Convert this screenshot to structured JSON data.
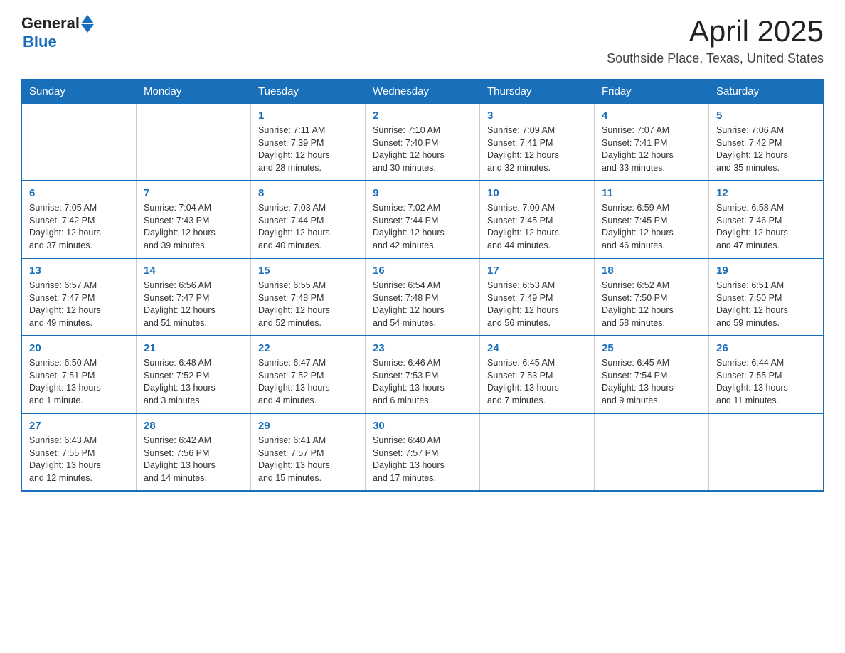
{
  "header": {
    "logo_general": "General",
    "logo_blue": "Blue",
    "month_year": "April 2025",
    "location": "Southside Place, Texas, United States"
  },
  "days_of_week": [
    "Sunday",
    "Monday",
    "Tuesday",
    "Wednesday",
    "Thursday",
    "Friday",
    "Saturday"
  ],
  "weeks": [
    [
      {
        "day": "",
        "info": ""
      },
      {
        "day": "",
        "info": ""
      },
      {
        "day": "1",
        "info": "Sunrise: 7:11 AM\nSunset: 7:39 PM\nDaylight: 12 hours\nand 28 minutes."
      },
      {
        "day": "2",
        "info": "Sunrise: 7:10 AM\nSunset: 7:40 PM\nDaylight: 12 hours\nand 30 minutes."
      },
      {
        "day": "3",
        "info": "Sunrise: 7:09 AM\nSunset: 7:41 PM\nDaylight: 12 hours\nand 32 minutes."
      },
      {
        "day": "4",
        "info": "Sunrise: 7:07 AM\nSunset: 7:41 PM\nDaylight: 12 hours\nand 33 minutes."
      },
      {
        "day": "5",
        "info": "Sunrise: 7:06 AM\nSunset: 7:42 PM\nDaylight: 12 hours\nand 35 minutes."
      }
    ],
    [
      {
        "day": "6",
        "info": "Sunrise: 7:05 AM\nSunset: 7:42 PM\nDaylight: 12 hours\nand 37 minutes."
      },
      {
        "day": "7",
        "info": "Sunrise: 7:04 AM\nSunset: 7:43 PM\nDaylight: 12 hours\nand 39 minutes."
      },
      {
        "day": "8",
        "info": "Sunrise: 7:03 AM\nSunset: 7:44 PM\nDaylight: 12 hours\nand 40 minutes."
      },
      {
        "day": "9",
        "info": "Sunrise: 7:02 AM\nSunset: 7:44 PM\nDaylight: 12 hours\nand 42 minutes."
      },
      {
        "day": "10",
        "info": "Sunrise: 7:00 AM\nSunset: 7:45 PM\nDaylight: 12 hours\nand 44 minutes."
      },
      {
        "day": "11",
        "info": "Sunrise: 6:59 AM\nSunset: 7:45 PM\nDaylight: 12 hours\nand 46 minutes."
      },
      {
        "day": "12",
        "info": "Sunrise: 6:58 AM\nSunset: 7:46 PM\nDaylight: 12 hours\nand 47 minutes."
      }
    ],
    [
      {
        "day": "13",
        "info": "Sunrise: 6:57 AM\nSunset: 7:47 PM\nDaylight: 12 hours\nand 49 minutes."
      },
      {
        "day": "14",
        "info": "Sunrise: 6:56 AM\nSunset: 7:47 PM\nDaylight: 12 hours\nand 51 minutes."
      },
      {
        "day": "15",
        "info": "Sunrise: 6:55 AM\nSunset: 7:48 PM\nDaylight: 12 hours\nand 52 minutes."
      },
      {
        "day": "16",
        "info": "Sunrise: 6:54 AM\nSunset: 7:48 PM\nDaylight: 12 hours\nand 54 minutes."
      },
      {
        "day": "17",
        "info": "Sunrise: 6:53 AM\nSunset: 7:49 PM\nDaylight: 12 hours\nand 56 minutes."
      },
      {
        "day": "18",
        "info": "Sunrise: 6:52 AM\nSunset: 7:50 PM\nDaylight: 12 hours\nand 58 minutes."
      },
      {
        "day": "19",
        "info": "Sunrise: 6:51 AM\nSunset: 7:50 PM\nDaylight: 12 hours\nand 59 minutes."
      }
    ],
    [
      {
        "day": "20",
        "info": "Sunrise: 6:50 AM\nSunset: 7:51 PM\nDaylight: 13 hours\nand 1 minute."
      },
      {
        "day": "21",
        "info": "Sunrise: 6:48 AM\nSunset: 7:52 PM\nDaylight: 13 hours\nand 3 minutes."
      },
      {
        "day": "22",
        "info": "Sunrise: 6:47 AM\nSunset: 7:52 PM\nDaylight: 13 hours\nand 4 minutes."
      },
      {
        "day": "23",
        "info": "Sunrise: 6:46 AM\nSunset: 7:53 PM\nDaylight: 13 hours\nand 6 minutes."
      },
      {
        "day": "24",
        "info": "Sunrise: 6:45 AM\nSunset: 7:53 PM\nDaylight: 13 hours\nand 7 minutes."
      },
      {
        "day": "25",
        "info": "Sunrise: 6:45 AM\nSunset: 7:54 PM\nDaylight: 13 hours\nand 9 minutes."
      },
      {
        "day": "26",
        "info": "Sunrise: 6:44 AM\nSunset: 7:55 PM\nDaylight: 13 hours\nand 11 minutes."
      }
    ],
    [
      {
        "day": "27",
        "info": "Sunrise: 6:43 AM\nSunset: 7:55 PM\nDaylight: 13 hours\nand 12 minutes."
      },
      {
        "day": "28",
        "info": "Sunrise: 6:42 AM\nSunset: 7:56 PM\nDaylight: 13 hours\nand 14 minutes."
      },
      {
        "day": "29",
        "info": "Sunrise: 6:41 AM\nSunset: 7:57 PM\nDaylight: 13 hours\nand 15 minutes."
      },
      {
        "day": "30",
        "info": "Sunrise: 6:40 AM\nSunset: 7:57 PM\nDaylight: 13 hours\nand 17 minutes."
      },
      {
        "day": "",
        "info": ""
      },
      {
        "day": "",
        "info": ""
      },
      {
        "day": "",
        "info": ""
      }
    ]
  ]
}
